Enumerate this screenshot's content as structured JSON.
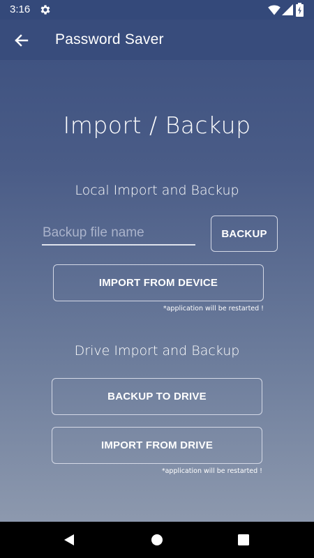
{
  "status_bar": {
    "time": "3:16",
    "icons": [
      "gear-icon",
      "wifi-icon",
      "signal-icon",
      "battery-charging-icon"
    ]
  },
  "app_bar": {
    "title": "Password Saver",
    "back_icon": "arrow-back-icon"
  },
  "main": {
    "page_title": "Import / Backup",
    "local_section": {
      "title": "Local Import and Backup",
      "backup_input": {
        "placeholder": "Backup file name",
        "value": ""
      },
      "backup_button": "BACKUP",
      "import_device_button": "IMPORT FROM DEVICE",
      "note": "*application will be restarted !"
    },
    "drive_section": {
      "title": "Drive Import and Backup",
      "backup_drive_button": "BACKUP TO DRIVE",
      "import_drive_button": "IMPORT FROM DRIVE",
      "note": "*application will be restarted !"
    }
  },
  "nav_bar": {
    "icons": [
      "nav-back-icon",
      "nav-home-icon",
      "nav-recent-icon"
    ]
  },
  "colors": {
    "gradient_top": "#3a4e7e",
    "gradient_bottom": "#949fb2",
    "app_bar": "#384c7c",
    "nav_bar": "#000000",
    "text": "#ffffff"
  }
}
